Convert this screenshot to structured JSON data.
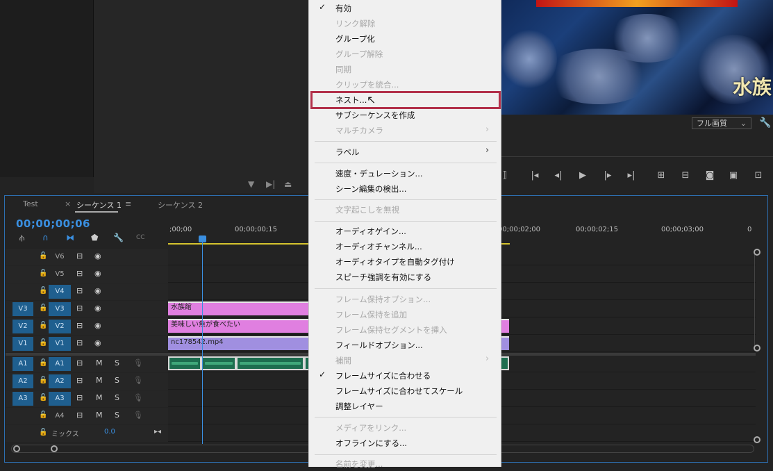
{
  "menu": {
    "items": [
      {
        "label": "有効",
        "checked": true,
        "disabled": false
      },
      {
        "label": "リンク解除",
        "disabled": true
      },
      {
        "label": "グループ化",
        "disabled": false
      },
      {
        "label": "グループ解除",
        "disabled": true
      },
      {
        "label": "同期",
        "disabled": true
      },
      {
        "label": "クリップを統合...",
        "disabled": true
      },
      {
        "label": "ネスト...",
        "disabled": false,
        "highlighted": true
      },
      {
        "label": "サブシーケンスを作成",
        "disabled": false
      },
      {
        "label": "マルチカメラ",
        "disabled": true,
        "submenu": true
      },
      {
        "label": "ラベル",
        "disabled": false,
        "submenu": true
      },
      {
        "label": "速度・デュレーション...",
        "disabled": false
      },
      {
        "label": "シーン編集の検出...",
        "disabled": false
      },
      {
        "label": "文字起こしを無視",
        "disabled": true
      },
      {
        "label": "オーディオゲイン...",
        "disabled": false
      },
      {
        "label": "オーディオチャンネル...",
        "disabled": false
      },
      {
        "label": "オーディオタイプを自動タグ付け",
        "disabled": false
      },
      {
        "label": "スピーチ強調を有効にする",
        "disabled": false
      },
      {
        "label": "フレーム保持オプション...",
        "disabled": true
      },
      {
        "label": "フレーム保持を追加",
        "disabled": true
      },
      {
        "label": "フレーム保持セグメントを挿入",
        "disabled": true
      },
      {
        "label": "フィールドオプション...",
        "disabled": false
      },
      {
        "label": "補間",
        "disabled": true,
        "submenu": true
      },
      {
        "label": "フレームサイズに合わせる",
        "checked": true,
        "disabled": false
      },
      {
        "label": "フレームサイズに合わせてスケール",
        "disabled": false
      },
      {
        "label": "調整レイヤー",
        "disabled": false
      },
      {
        "label": "メディアをリンク...",
        "disabled": true
      },
      {
        "label": "オフラインにする...",
        "disabled": false
      },
      {
        "label": "名前を変更...",
        "disabled": true
      }
    ]
  },
  "program": {
    "overlay_text": "水族",
    "quality": "フル画質"
  },
  "timeline": {
    "tabs": [
      "Test",
      "シーケンス 1",
      "シーケンス 2"
    ],
    "timecode": "00;00;00;06",
    "ruler": [
      ";00;00",
      "00;00;00;15",
      "00;00;02;00",
      "00;00;02;15",
      "00;00;03;00",
      "0"
    ],
    "video_tracks": [
      {
        "target": "",
        "name": "V6"
      },
      {
        "target": "",
        "name": "V5"
      },
      {
        "target": "",
        "name": "V4"
      },
      {
        "target": "V3",
        "name": "V3"
      },
      {
        "target": "V2",
        "name": "V2"
      },
      {
        "target": "V1",
        "name": "V1"
      }
    ],
    "audio_tracks": [
      {
        "target": "A1",
        "name": "A1"
      },
      {
        "target": "A2",
        "name": "A2"
      },
      {
        "target": "A3",
        "name": "A3"
      },
      {
        "target": "",
        "name": "A4"
      }
    ],
    "mix_label": "ミックス",
    "mix_value": "0.0",
    "mute": "M",
    "solo": "S",
    "clips": {
      "v3": "水族館",
      "v2": "美味しい魚が食べたい",
      "v1": "nc178542.mp4"
    },
    "colors": {
      "accent": "#3a8fe0",
      "title_clip": "#e07fe0",
      "video_clip": "#a08fe0",
      "audio_clip": "#1d6d4f",
      "highlight": "#b2304a"
    }
  }
}
